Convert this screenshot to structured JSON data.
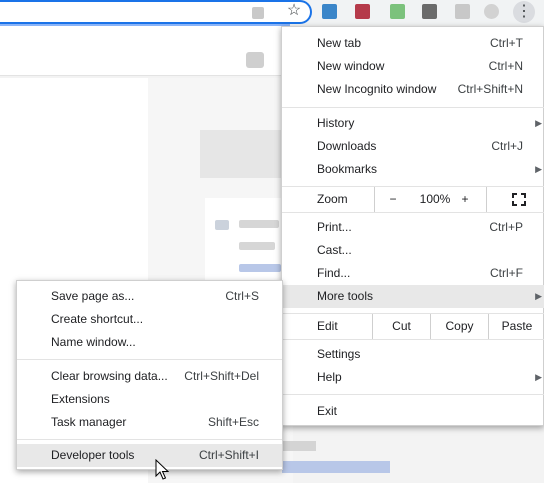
{
  "toolbar": {
    "bookmark_icon": "star-icon",
    "extensions": [
      "extension-icon",
      "extension-icon",
      "extension-icon",
      "extension-icon",
      "extension-icon",
      "extension-icon"
    ],
    "menu_icon": "kebab-icon",
    "accent_color": "#1a73e8"
  },
  "menu": {
    "new_tab": {
      "label": "New tab",
      "shortcut": "Ctrl+T"
    },
    "new_window": {
      "label": "New window",
      "shortcut": "Ctrl+N"
    },
    "new_incognito": {
      "label": "New Incognito window",
      "shortcut": "Ctrl+Shift+N"
    },
    "history": {
      "label": "History"
    },
    "downloads": {
      "label": "Downloads",
      "shortcut": "Ctrl+J"
    },
    "bookmarks": {
      "label": "Bookmarks"
    },
    "zoom": {
      "label": "Zoom",
      "minus": "−",
      "value": "100%",
      "plus": "+"
    },
    "print": {
      "label": "Print...",
      "shortcut": "Ctrl+P"
    },
    "cast": {
      "label": "Cast..."
    },
    "find": {
      "label": "Find...",
      "shortcut": "Ctrl+F"
    },
    "more_tools": {
      "label": "More tools"
    },
    "edit": {
      "label": "Edit",
      "cut": "Cut",
      "copy": "Copy",
      "paste": "Paste"
    },
    "settings": {
      "label": "Settings"
    },
    "help": {
      "label": "Help"
    },
    "exit": {
      "label": "Exit"
    }
  },
  "more_tools_menu": {
    "save_page": {
      "label": "Save page as...",
      "shortcut": "Ctrl+S"
    },
    "create_shortcut": {
      "label": "Create shortcut..."
    },
    "name_window": {
      "label": "Name window..."
    },
    "clear_browsing": {
      "label": "Clear browsing data...",
      "shortcut": "Ctrl+Shift+Del"
    },
    "extensions": {
      "label": "Extensions"
    },
    "task_manager": {
      "label": "Task manager",
      "shortcut": "Shift+Esc"
    },
    "developer_tools": {
      "label": "Developer tools",
      "shortcut": "Ctrl+Shift+I"
    }
  }
}
